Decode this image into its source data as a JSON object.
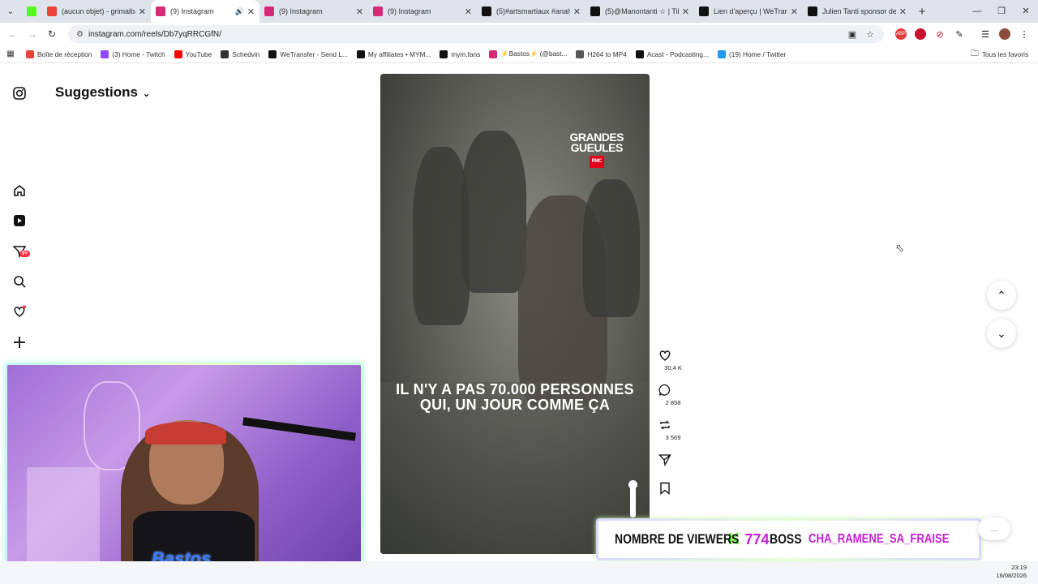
{
  "browser": {
    "tabs": [
      {
        "title": "(aucun objet) - grimalba",
        "icon": "gmail-icon",
        "color": "#ea4335"
      },
      {
        "title": "(9) Instagram",
        "icon": "instagram-icon",
        "color": "#d62976",
        "active": true,
        "audio": true
      },
      {
        "title": "(9) Instagram",
        "icon": "instagram-icon",
        "color": "#d62976"
      },
      {
        "title": "(9) Instagram",
        "icon": "instagram-icon",
        "color": "#d62976"
      },
      {
        "title": "(5)#artsmartiaux #analys",
        "icon": "tiktok-icon",
        "color": "#111111"
      },
      {
        "title": "(5)@Manontanti ☆ | TikT",
        "icon": "tiktok-icon",
        "color": "#111111"
      },
      {
        "title": "Lien d'aperçu | WeTransf",
        "icon": "wetransfer-icon",
        "color": "#111111"
      },
      {
        "title": "Julien Tanti sponsor de",
        "icon": "tiktok-icon",
        "color": "#111111"
      }
    ],
    "url": "instagram.com/reels/Db7yqRRCGfN/",
    "bookmarks": [
      {
        "label": "Boîte de réception",
        "color": "#ea4335"
      },
      {
        "label": "(3) Home - Twitch",
        "color": "#9146ff"
      },
      {
        "label": "YouTube",
        "color": "#ff0000"
      },
      {
        "label": "Schedvin",
        "color": "#333333"
      },
      {
        "label": "WeTransfer - Send L...",
        "color": "#111111"
      },
      {
        "label": "My affiliates • MYM...",
        "color": "#111111"
      },
      {
        "label": "mym.fans",
        "color": "#111111"
      },
      {
        "label": "⚡Bastos⚡ (@bast...",
        "color": "#d62976"
      },
      {
        "label": "H264 to MP4",
        "color": "#555555"
      },
      {
        "label": "Acast - Podcasting...",
        "color": "#111111"
      },
      {
        "label": "(19) Home / Twitter",
        "color": "#1d9bf0"
      }
    ],
    "all_bookmarks": "Tous les favoris"
  },
  "instagram": {
    "suggestions": "Suggestions",
    "notification_badge": "9+",
    "reel": {
      "caption": "IL N'Y A PAS 70.000 PERSONNES QUI, UN JOUR COMME ÇA",
      "logo_line1": "GRANDES",
      "logo_line2": "GUEULES",
      "logo_rmc": "RMC",
      "likes": "30,4 K",
      "comments": "2 858",
      "reposts": "3 569"
    }
  },
  "overlay": {
    "viewers_label": "NOMBRE DE VIEWERS",
    "kick_glyph": "K",
    "viewers_count": "774",
    "boss_label": "BOSS",
    "boss_user": "CHA_RAMENE_SA_FRAISE",
    "webcam_shirt": "Bastos"
  },
  "taskbar": {
    "time": "23:19",
    "date": "16/08/2026"
  }
}
